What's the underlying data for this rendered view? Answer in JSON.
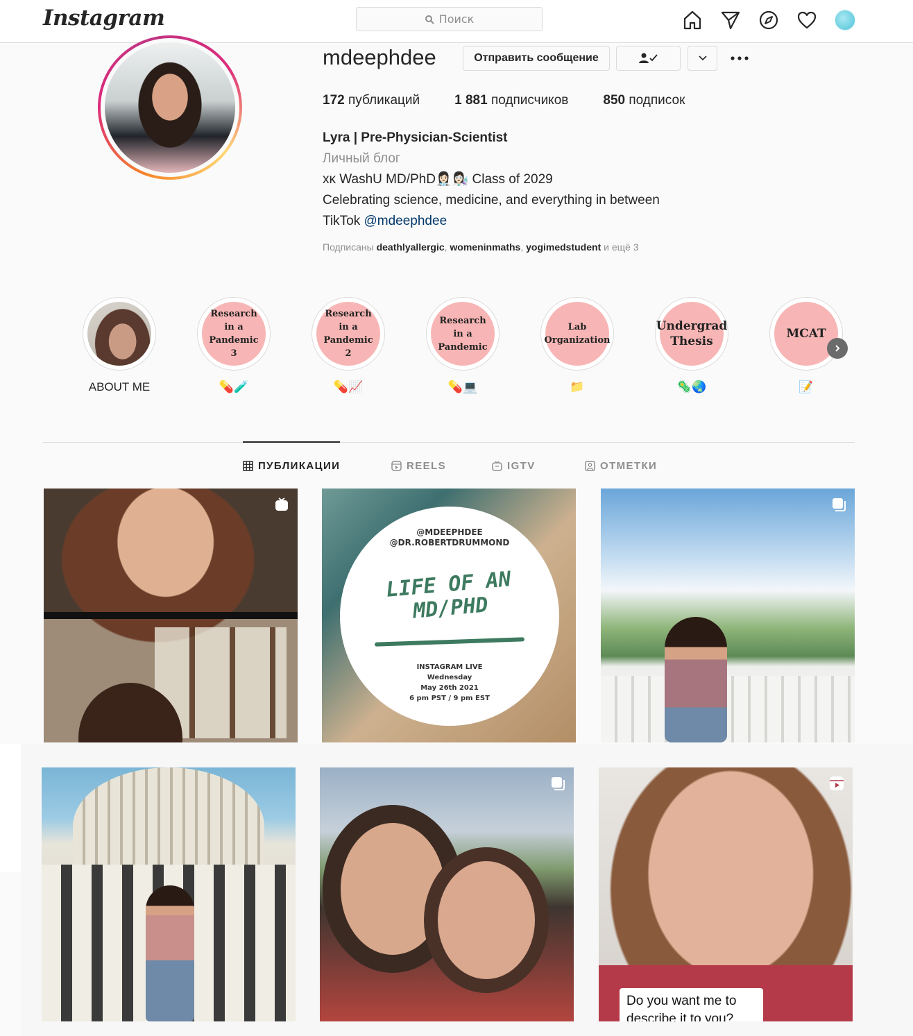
{
  "header": {
    "logo": "Instagram",
    "search_placeholder": "Поиск",
    "icons": [
      "home-icon",
      "direct-icon",
      "explore-icon",
      "activity-heart-icon",
      "profile-avatar-icon"
    ]
  },
  "profile": {
    "username": "mdeephdee",
    "message_button": "Отправить сообщение",
    "stats": {
      "posts_count": "172",
      "posts_label": "публикаций",
      "followers_count": "1 881",
      "followers_label": "подписчиков",
      "following_count": "850",
      "following_label": "подписок"
    },
    "bio": {
      "full_name": "Lyra | Pre-Physician-Scientist",
      "category": "Личный блог",
      "line1": "xκ WashU MD/PhD👩🏻‍⚕️👩🏻‍🔬 Class of 2029",
      "line2": "Celebrating science, medicine, and everything in between",
      "line3_prefix": "TikTok",
      "line3_link": "@mdeephdee"
    },
    "followed_by": {
      "prefix": "Подписаны",
      "user1": "deathlyallergic",
      "sep": ",",
      "user2": "womeninmaths",
      "user3": "yogimedstudent",
      "suffix": "и ещё 3"
    }
  },
  "highlights": [
    {
      "cover_text": "",
      "label": "ABOUT ME"
    },
    {
      "cover_text": "Research in a Pandemic 3",
      "label": "💊🧪"
    },
    {
      "cover_text": "Research in a Pandemic 2",
      "label": "💊📈"
    },
    {
      "cover_text": "Research in a Pandemic",
      "label": "💊💻"
    },
    {
      "cover_text": "Lab Organization",
      "label": "📁"
    },
    {
      "cover_text": "Undergrad Thesis",
      "label": "🦠🌏"
    },
    {
      "cover_text": "MCAT",
      "label": "📝"
    }
  ],
  "tabs": [
    {
      "label": "ПУБЛИКАЦИИ",
      "icon": "grid-icon",
      "active": true
    },
    {
      "label": "REELS",
      "icon": "reels-icon",
      "active": false
    },
    {
      "label": "IGTV",
      "icon": "igtv-icon",
      "active": false
    },
    {
      "label": "ОТМЕТКИ",
      "icon": "tagged-icon",
      "active": false
    }
  ],
  "posts": {
    "p2": {
      "handle1": "@MDEEPHDEE",
      "handle2": "@DR.ROBERTDRUMMOND",
      "title1": "LIFE OF AN",
      "title2": "MD/PHD",
      "live1": "INSTAGRAM LIVE",
      "live2": "Wednesday",
      "live3": "May 26th 2021",
      "live4": "6 pm PST / 9 pm EST"
    },
    "p6": {
      "caption": "Do you want me to describe it to you?"
    },
    "badges": [
      "igtv-icon",
      "none",
      "carousel-icon",
      "none",
      "carousel-icon",
      "reels-icon"
    ]
  }
}
